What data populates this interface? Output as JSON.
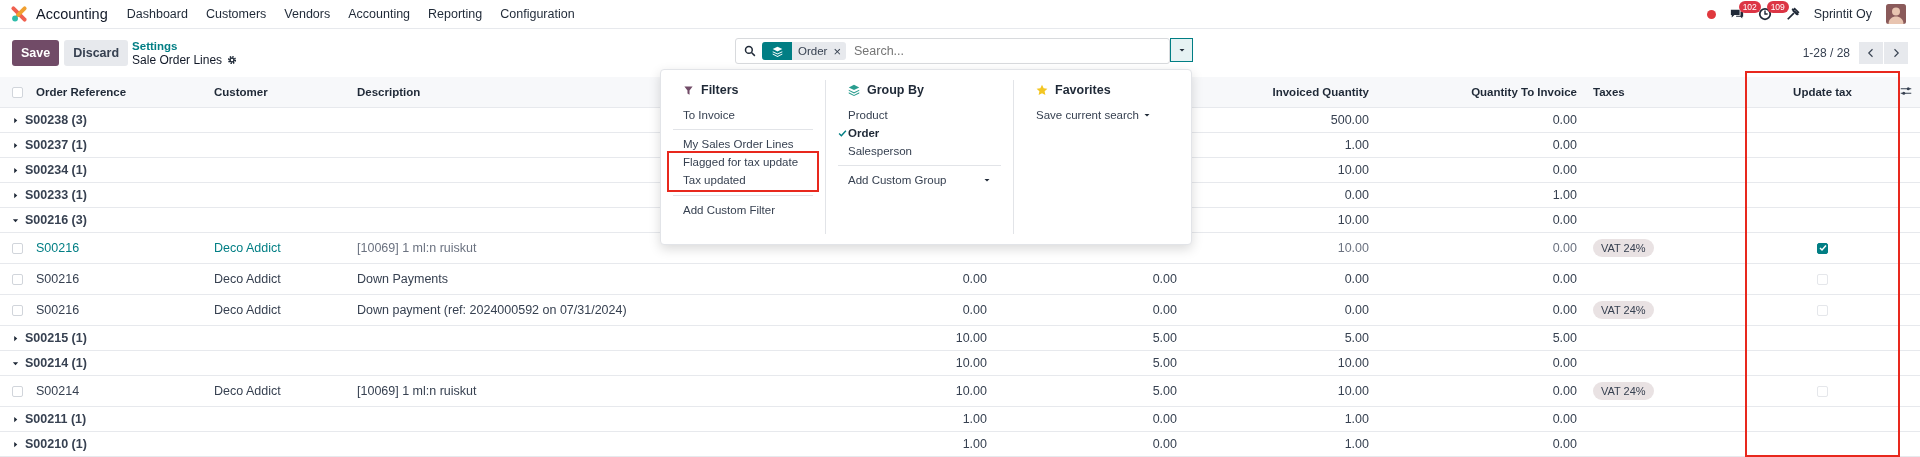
{
  "navbar": {
    "app_name": "Accounting",
    "menus": [
      "Dashboard",
      "Customers",
      "Vendors",
      "Accounting",
      "Reporting",
      "Configuration"
    ],
    "messages_badge": "102",
    "activities_badge": "109",
    "company": "Sprintit Oy"
  },
  "control_panel": {
    "save_label": "Save",
    "discard_label": "Discard",
    "breadcrumb_parent": "Settings",
    "breadcrumb_current": "Sale Order Lines",
    "pager": "1-28 / 28"
  },
  "search": {
    "facet": "Order",
    "facet_remove": "×",
    "placeholder": "Search...",
    "dropdown_open": true
  },
  "search_panel": {
    "filters": {
      "title": "Filters",
      "groups": [
        [
          {
            "items": [
              "To Invoice"
            ],
            "highlighted": false
          }
        ],
        [
          {
            "items": [
              "My Sales Order Lines"
            ],
            "highlighted": false
          },
          {
            "items": [
              "Flagged for tax update",
              "Tax updated"
            ],
            "highlighted": true
          }
        ],
        [
          {
            "items": [
              "Add Custom Filter"
            ],
            "highlighted": false
          }
        ]
      ]
    },
    "group_by": {
      "title": "Group By",
      "options": [
        {
          "label": "Product",
          "selected": false
        },
        {
          "label": "Order",
          "selected": true
        },
        {
          "label": "Salesperson",
          "selected": false
        }
      ],
      "custom_label": "Add Custom Group"
    },
    "favorites": {
      "title": "Favorites",
      "save_label": "Save current search"
    }
  },
  "table": {
    "all_selected": false,
    "columns": [
      {
        "label": "Order Reference"
      },
      {
        "label": "Customer"
      },
      {
        "label": "Description"
      },
      {},
      {},
      {
        "label": "Invoiced Quantity"
      },
      {
        "label": "Quantity To Invoice"
      },
      {
        "label": "Taxes"
      },
      {
        "label": "Update tax",
        "highlighted": true
      }
    ],
    "rows": [
      {
        "kind": "group",
        "label": "S00238 (3)",
        "expanded": false,
        "values": {
          "invoiced": "500.00",
          "to_invoice": "0.00"
        }
      },
      {
        "kind": "group",
        "label": "S00237 (1)",
        "expanded": false,
        "values": {
          "invoiced": "1.00",
          "to_invoice": "0.00"
        }
      },
      {
        "kind": "group",
        "label": "S00234 (1)",
        "expanded": false,
        "values": {
          "invoiced": "10.00",
          "to_invoice": "0.00"
        }
      },
      {
        "kind": "group",
        "label": "S00233 (1)",
        "expanded": false,
        "values": {
          "invoiced": "0.00",
          "to_invoice": "1.00"
        }
      },
      {
        "kind": "group",
        "label": "S00216 (3)",
        "expanded": true,
        "values": {
          "invoiced": "10.00",
          "to_invoice": "0.00"
        }
      },
      {
        "kind": "line",
        "selected": false,
        "editing": true,
        "order": "S00216",
        "customer": "Deco Addict",
        "description": "[10069] 1 ml:n ruiskut",
        "values": {
          "invoiced": "10.00",
          "to_invoice": "0.00"
        },
        "taxes": [
          "VAT 24%"
        ],
        "update_tax": true
      },
      {
        "kind": "line",
        "selected": false,
        "editing": false,
        "order": "S00216",
        "customer": "Deco Addict",
        "description": "Down Payments",
        "values": {
          "column_4": "0.00",
          "column_5": "0.00",
          "invoiced": "0.00",
          "to_invoice": "0.00"
        },
        "taxes": [],
        "update_tax": false
      },
      {
        "kind": "line",
        "selected": false,
        "editing": false,
        "order": "S00216",
        "customer": "Deco Addict",
        "description": "Down payment (ref: 2024000592 on 07/31/2024)",
        "values": {
          "column_4": "0.00",
          "column_5": "0.00",
          "invoiced": "0.00",
          "to_invoice": "0.00"
        },
        "taxes": [
          "VAT 24%"
        ],
        "update_tax": false
      },
      {
        "kind": "group",
        "label": "S00215 (1)",
        "expanded": false,
        "values": {
          "column_4": "10.00",
          "column_5": "5.00",
          "invoiced": "5.00",
          "to_invoice": "5.00"
        }
      },
      {
        "kind": "group",
        "label": "S00214 (1)",
        "expanded": true,
        "values": {
          "column_4": "10.00",
          "column_5": "5.00",
          "invoiced": "10.00",
          "to_invoice": "0.00"
        }
      },
      {
        "kind": "line",
        "selected": false,
        "editing": false,
        "order": "S00214",
        "customer": "Deco Addict",
        "description": "[10069] 1 ml:n ruiskut",
        "values": {
          "column_4": "10.00",
          "column_5": "5.00",
          "invoiced": "10.00",
          "to_invoice": "0.00"
        },
        "taxes": [
          "VAT 24%"
        ],
        "update_tax": false
      },
      {
        "kind": "group",
        "label": "S00211 (1)",
        "expanded": false,
        "values": {
          "column_4": "1.00",
          "column_5": "0.00",
          "invoiced": "1.00",
          "to_invoice": "0.00"
        }
      },
      {
        "kind": "group",
        "label": "S00210 (1)",
        "expanded": false,
        "values": {
          "column_4": "1.00",
          "column_5": "0.00",
          "invoiced": "1.00",
          "to_invoice": "0.00"
        }
      }
    ]
  }
}
